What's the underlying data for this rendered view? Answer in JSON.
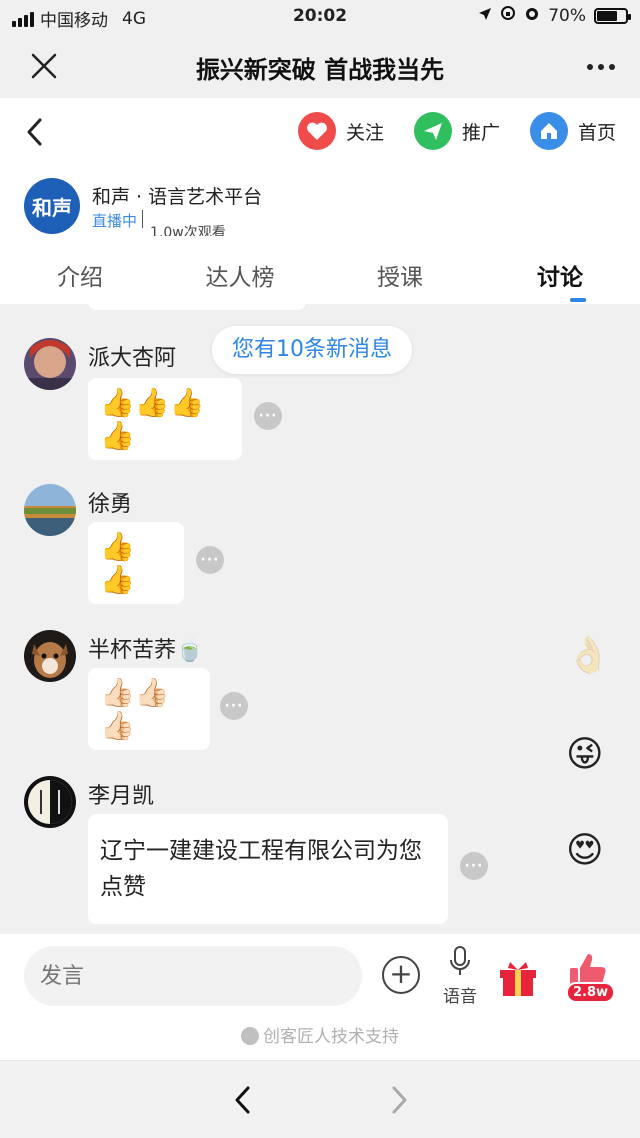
{
  "status_bar": {
    "carrier": "中国移动",
    "network": "4G",
    "time": "20:02",
    "battery": "70%",
    "battery_level": 0.7
  },
  "title_bar": {
    "title": "振兴新突破 首战我当先"
  },
  "nav": {
    "follow_label": "关注",
    "promote_label": "推广",
    "home_label": "首页",
    "colors": {
      "follow": "#f04b4b",
      "promote": "#2fbf5e",
      "home": "#3a8ee8"
    }
  },
  "channel": {
    "logo_text": "和声",
    "name": "和声 · 语言艺术平台",
    "live": "直播中",
    "views": "1.0w次观看"
  },
  "tabs": [
    {
      "label": "介绍"
    },
    {
      "label": "达人榜"
    },
    {
      "label": "授课"
    },
    {
      "label": "讨论"
    }
  ],
  "new_messages": "您有10条新消息",
  "messages": [
    {
      "sender": "派大杏阿",
      "content": "👍👍👍👍"
    },
    {
      "sender": "徐勇",
      "content": "👍 👍"
    },
    {
      "sender": "半杯苦荞🍵",
      "content": "👍🏻👍🏻👍🏻"
    },
    {
      "sender": "李月凯",
      "content": "辽宁一建建设工程有限公司为您点赞"
    }
  ],
  "input": {
    "placeholder": "发言",
    "voice_label": "语音",
    "like_count": "2.8w"
  },
  "support_text": "创客匠人技术支持"
}
